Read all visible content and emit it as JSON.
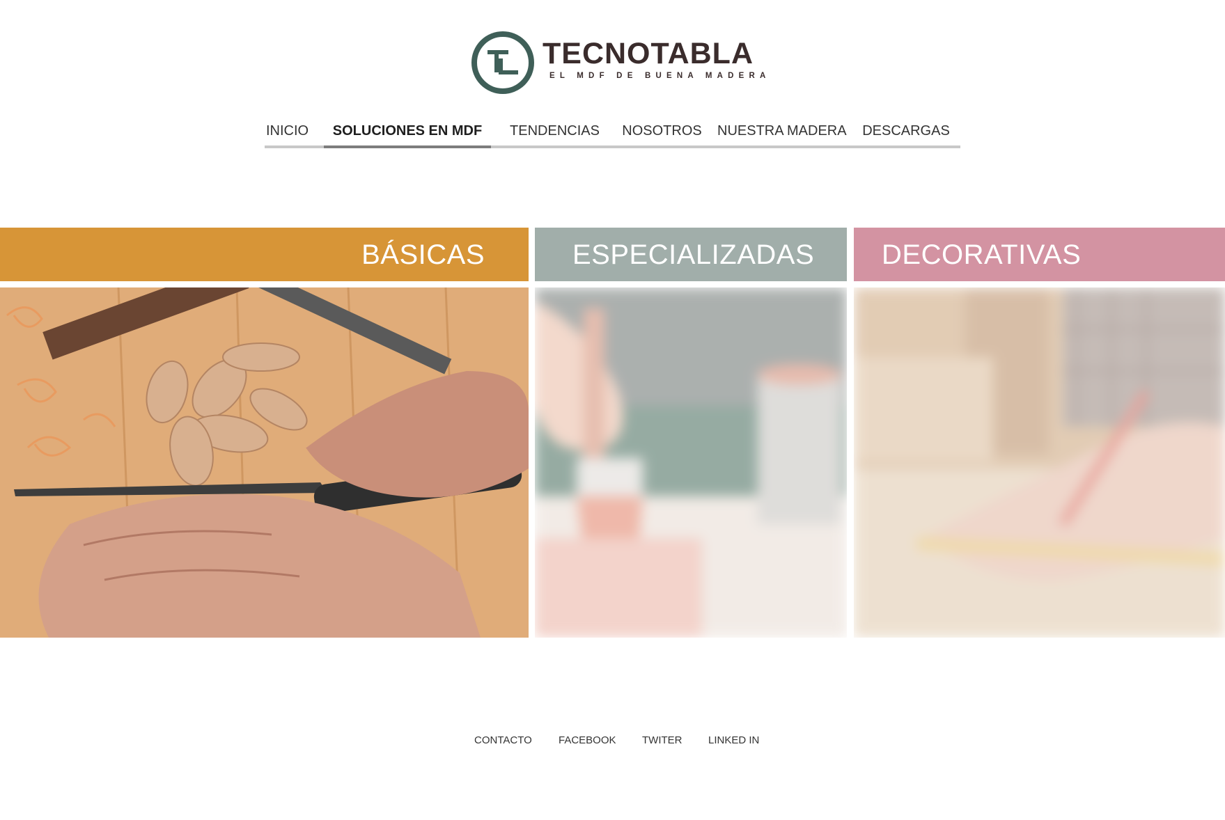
{
  "brand": {
    "title": "TECNOTABLA",
    "tagline": "EL MDF DE BUENA MADERA",
    "logo_icon": "tl-ring-logo-icon",
    "colors": {
      "ring": "#3f5f58",
      "text": "#3a2c2c"
    }
  },
  "nav": {
    "items": [
      {
        "label": "INICIO"
      },
      {
        "label": "SOLUCIONES EN MDF"
      },
      {
        "label": "TENDENCIAS"
      },
      {
        "label": "NOSOTROS"
      },
      {
        "label": "NUESTRA MADERA"
      },
      {
        "label": "DESCARGAS"
      }
    ],
    "active": "SOLUCIONES EN MDF"
  },
  "categories": [
    {
      "label": "BÁSICAS",
      "color": "#d79537",
      "state": "active"
    },
    {
      "label": "ESPECIALIZADAS",
      "color": "#a1aeaa",
      "state": "dimmed"
    },
    {
      "label": "DECORATIVAS",
      "color": "#d393a2",
      "state": "dimmed"
    }
  ],
  "footer": {
    "links": [
      {
        "label": "CONTACTO"
      },
      {
        "label": "FACEBOOK"
      },
      {
        "label": "TWITER"
      },
      {
        "label": "LINKED IN"
      }
    ]
  }
}
